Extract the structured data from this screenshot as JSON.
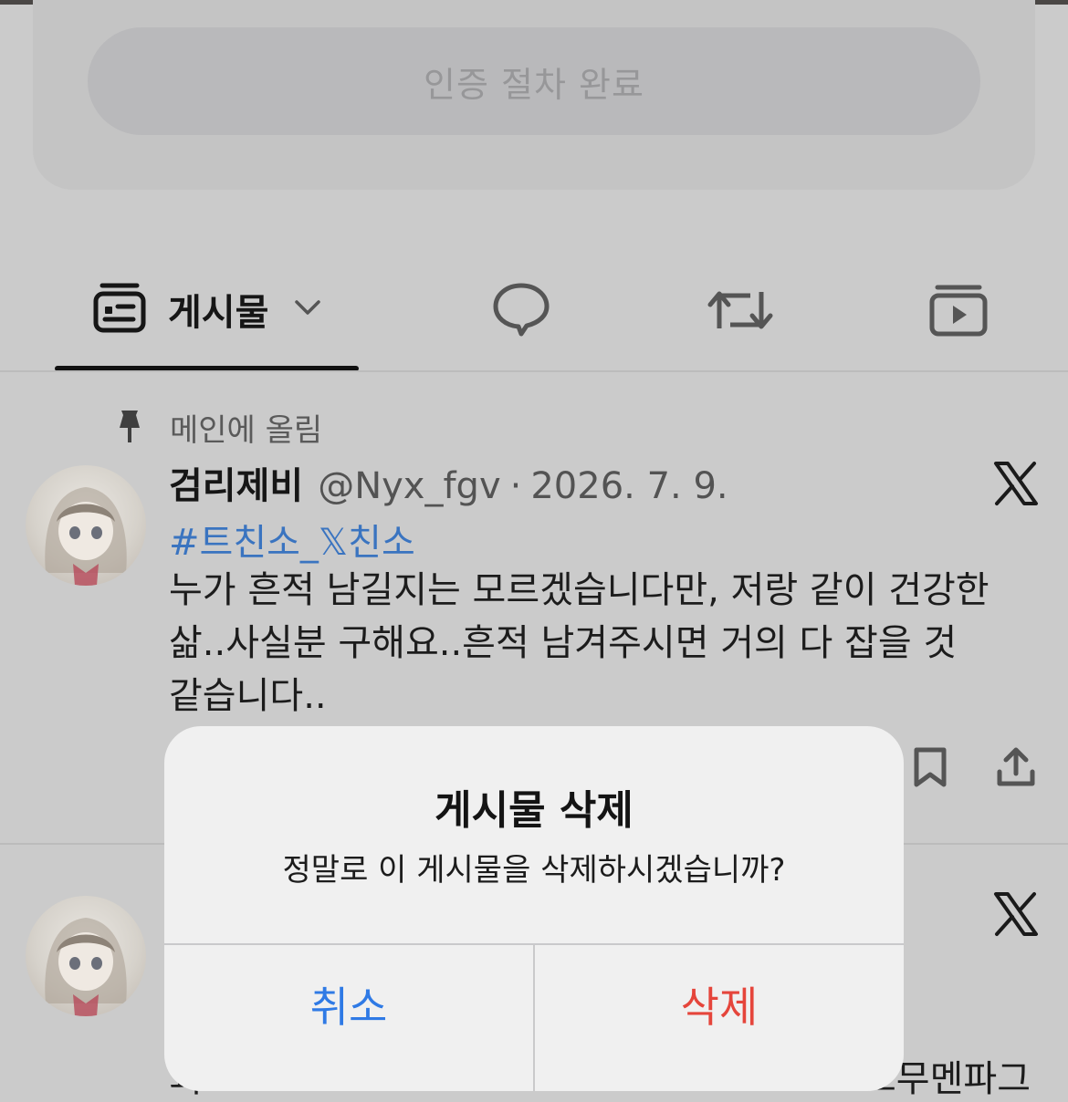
{
  "verification": {
    "button_label": "인증 절차 완료"
  },
  "tabs": {
    "posts_label": "게시물",
    "icons": [
      "posts-icon",
      "chevron-down-icon",
      "replies-icon",
      "reposts-icon",
      "media-icon"
    ]
  },
  "post": {
    "pinned_label": "메인에 올림",
    "display_name": "검리제비",
    "handle": "@Nyx_fgv",
    "separator": "·",
    "date": "2026. 7. 9.",
    "hashtag": "#트친소_𝕏친소",
    "body": "누가 흔적 남길지는 모르겠습니다만, 저랑 같이 건강한 삶..사실분 구해요..흔적 남겨주시면 거의 다 잡을 것 같습니다..",
    "action_icons": [
      "bookmark-icon",
      "share-icon"
    ]
  },
  "second_post": {
    "partial_left": "괴",
    "partial_right": "스무멘파그"
  },
  "alert": {
    "title": "게시물 삭제",
    "message": "정말로 이 게시물을 삭제하시겠습니까?",
    "cancel_label": "취소",
    "delete_label": "삭제"
  },
  "colors": {
    "background": "#cbcbcb",
    "link": "#3a74c0",
    "cancel": "#2f7ae5",
    "destructive": "#e5453b"
  }
}
